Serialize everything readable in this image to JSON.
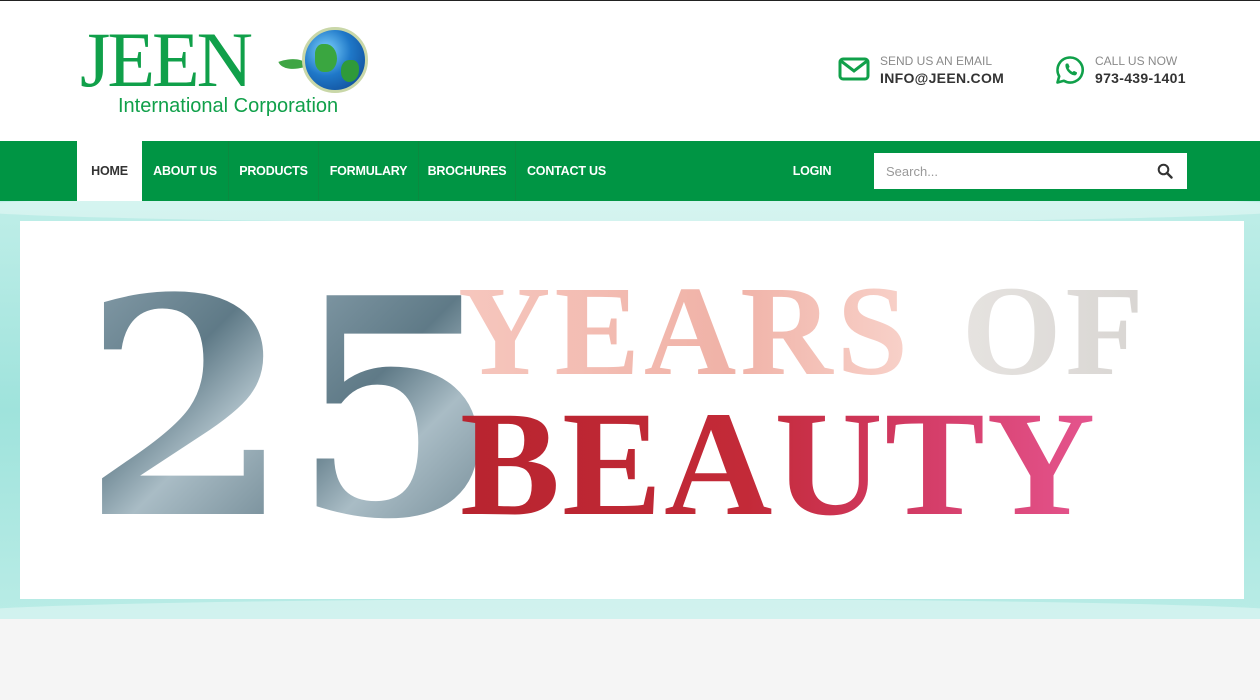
{
  "brand": {
    "name": "JEEN",
    "subtitle": "International Corporation"
  },
  "contact": {
    "email_label": "SEND US AN EMAIL",
    "email": "INFO@JEEN.COM",
    "phone_label": "CALL US NOW",
    "phone": "973-439-1401"
  },
  "nav": {
    "items": [
      {
        "label": "HOME",
        "active": true
      },
      {
        "label": "ABOUT US"
      },
      {
        "label": "PRODUCTS"
      },
      {
        "label": "FORMULARY"
      },
      {
        "label": "BROCHURES"
      },
      {
        "label": "CONTACT US"
      }
    ],
    "login": "LOGIN"
  },
  "search": {
    "placeholder": "Search...",
    "icon": "search-icon"
  },
  "hero": {
    "number": "25",
    "digit1": "2",
    "digit2": "5",
    "line1": "YEARS",
    "line1b": "OF",
    "line2": "BEAUTY"
  },
  "colors": {
    "brand_green": "#009544",
    "logo_green": "#10a04a",
    "beauty_red": "#c32a38"
  }
}
